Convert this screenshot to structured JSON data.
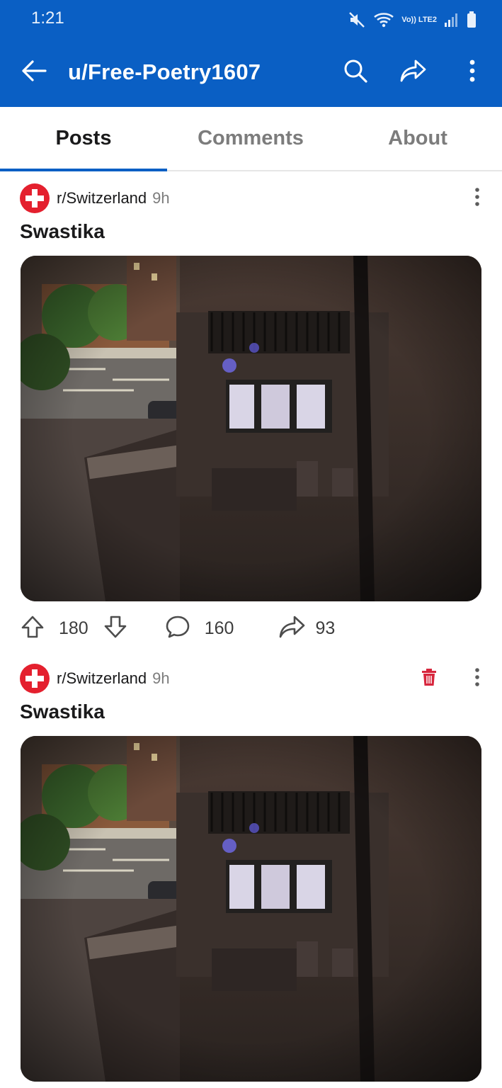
{
  "status_bar": {
    "time": "1:21",
    "network_label": "Vo)) LTE2"
  },
  "header": {
    "title": "u/Free-Poetry1607",
    "icons": [
      "back-arrow-icon",
      "search-icon",
      "share-icon",
      "more-vertical-icon"
    ],
    "background_color": "#0a5fc4"
  },
  "tabs": [
    {
      "label": "Posts",
      "active": true
    },
    {
      "label": "Comments",
      "active": false
    },
    {
      "label": "About",
      "active": false
    }
  ],
  "posts": [
    {
      "subreddit": "r/Switzerland",
      "age": "9h",
      "title": "Swastika",
      "upvotes": "180",
      "comments": "160",
      "shares": "93",
      "show_delete": false
    },
    {
      "subreddit": "r/Switzerland",
      "age": "9h",
      "title": "Swastika",
      "upvotes": "",
      "comments": "",
      "shares": "",
      "show_delete": true
    }
  ],
  "colors": {
    "accent": "#0a5fc4",
    "subreddit_icon": "#e4202e",
    "delete_icon": "#d7263d"
  }
}
